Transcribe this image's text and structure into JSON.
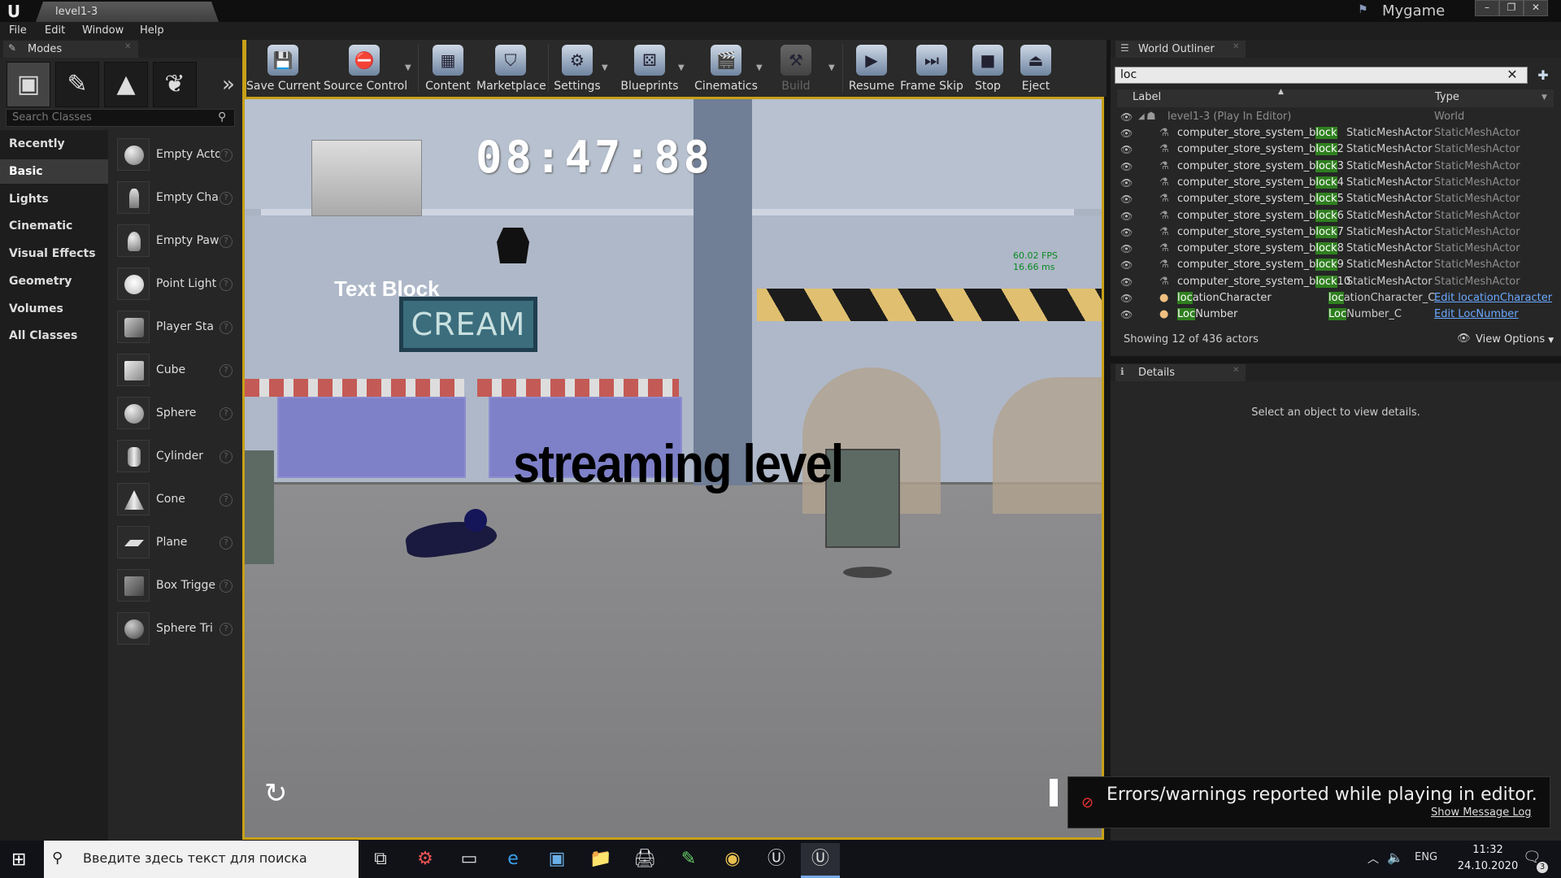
{
  "titlebar": {
    "doc_tab": "level1-3",
    "project": "Mygame",
    "buttons": [
      "–",
      "❐",
      "✕"
    ]
  },
  "menu": [
    "File",
    "Edit",
    "Window",
    "Help"
  ],
  "modes": {
    "tab_label": "Modes",
    "search_placeholder": "Search Classes",
    "categories": [
      "Recently Placed",
      "Basic",
      "Lights",
      "Cinematic",
      "Visual Effects",
      "Geometry",
      "Volumes",
      "All Classes"
    ],
    "items": [
      "Empty Acto",
      "Empty Cha",
      "Empty Paw",
      "Point Light",
      "Player Sta",
      "Cube",
      "Sphere",
      "Cylinder",
      "Cone",
      "Plane",
      "Box Trigge",
      "Sphere Tri"
    ]
  },
  "toolbar": {
    "save": "Save Current",
    "source_control": "Source Control",
    "content": "Content",
    "marketplace": "Marketplace",
    "settings": "Settings",
    "blueprints": "Blueprints",
    "cinematics": "Cinematics",
    "build": "Build",
    "resume": "Resume",
    "frame_skip": "Frame Skip",
    "stop": "Stop",
    "eject": "Eject"
  },
  "viewport": {
    "timer": "08:47:88",
    "text_block": "Text Block",
    "sign": "CREAM",
    "streaming": "streaming level",
    "fps": "60.02 FPS",
    "ms": "16.66 ms"
  },
  "outliner": {
    "tab_label": "World Outliner",
    "search_value": "loc",
    "col_label": "Label",
    "col_type": "Type",
    "root": {
      "label": "level1-3 (Play In Editor)",
      "type": "World"
    },
    "rows": [
      {
        "pre": "computer_store_system_b",
        "hl": "lock",
        "post": "",
        "cls": "StaticMeshActor",
        "type": "StaticMeshActor"
      },
      {
        "pre": "computer_store_system_b",
        "hl": "lock",
        "post": "2",
        "cls": "StaticMeshActor",
        "type": "StaticMeshActor"
      },
      {
        "pre": "computer_store_system_b",
        "hl": "lock",
        "post": "3",
        "cls": "StaticMeshActor",
        "type": "StaticMeshActor"
      },
      {
        "pre": "computer_store_system_b",
        "hl": "lock",
        "post": "4",
        "cls": "StaticMeshActor",
        "type": "StaticMeshActor"
      },
      {
        "pre": "computer_store_system_b",
        "hl": "lock",
        "post": "5",
        "cls": "StaticMeshActor",
        "type": "StaticMeshActor"
      },
      {
        "pre": "computer_store_system_b",
        "hl": "lock",
        "post": "6",
        "cls": "StaticMeshActor",
        "type": "StaticMeshActor"
      },
      {
        "pre": "computer_store_system_b",
        "hl": "lock",
        "post": "7",
        "cls": "StaticMeshActor",
        "type": "StaticMeshActor"
      },
      {
        "pre": "computer_store_system_b",
        "hl": "lock",
        "post": "8",
        "cls": "StaticMeshActor",
        "type": "StaticMeshActor"
      },
      {
        "pre": "computer_store_system_b",
        "hl": "lock",
        "post": "9",
        "cls": "StaticMeshActor",
        "type": "StaticMeshActor"
      },
      {
        "pre": "computer_store_system_b",
        "hl": "lock",
        "post": "10",
        "cls": "StaticMeshActor",
        "type": "StaticMeshActor"
      },
      {
        "pre": "",
        "hl": "loc",
        "post": "ationCharacter",
        "cls_hl": "loc",
        "cls": "ationCharacter_C",
        "type": "Edit locationCharacter",
        "link": true
      },
      {
        "pre": "",
        "hl": "Loc",
        "post": "Number",
        "cls_hl": "Loc",
        "cls": "Number_C",
        "type": "Edit LocNumber",
        "link": true
      }
    ],
    "showing": "Showing 12 of 436 actors",
    "view_options": "View Options"
  },
  "details": {
    "tab_label": "Details",
    "empty": "Select an object to view details."
  },
  "notification": {
    "text": "Errors/warnings reported while playing in editor.",
    "link": "Show Message Log"
  },
  "taskbar": {
    "search_placeholder": "Введите здесь текст для поиска",
    "lang": "ENG",
    "time": "11:32",
    "date": "24.10.2020",
    "notif_count": "3"
  },
  "colors": {
    "accent": "#c8a018",
    "highlight": "#2f7f1f",
    "link": "#6aa8ff",
    "error": "#e33333"
  }
}
